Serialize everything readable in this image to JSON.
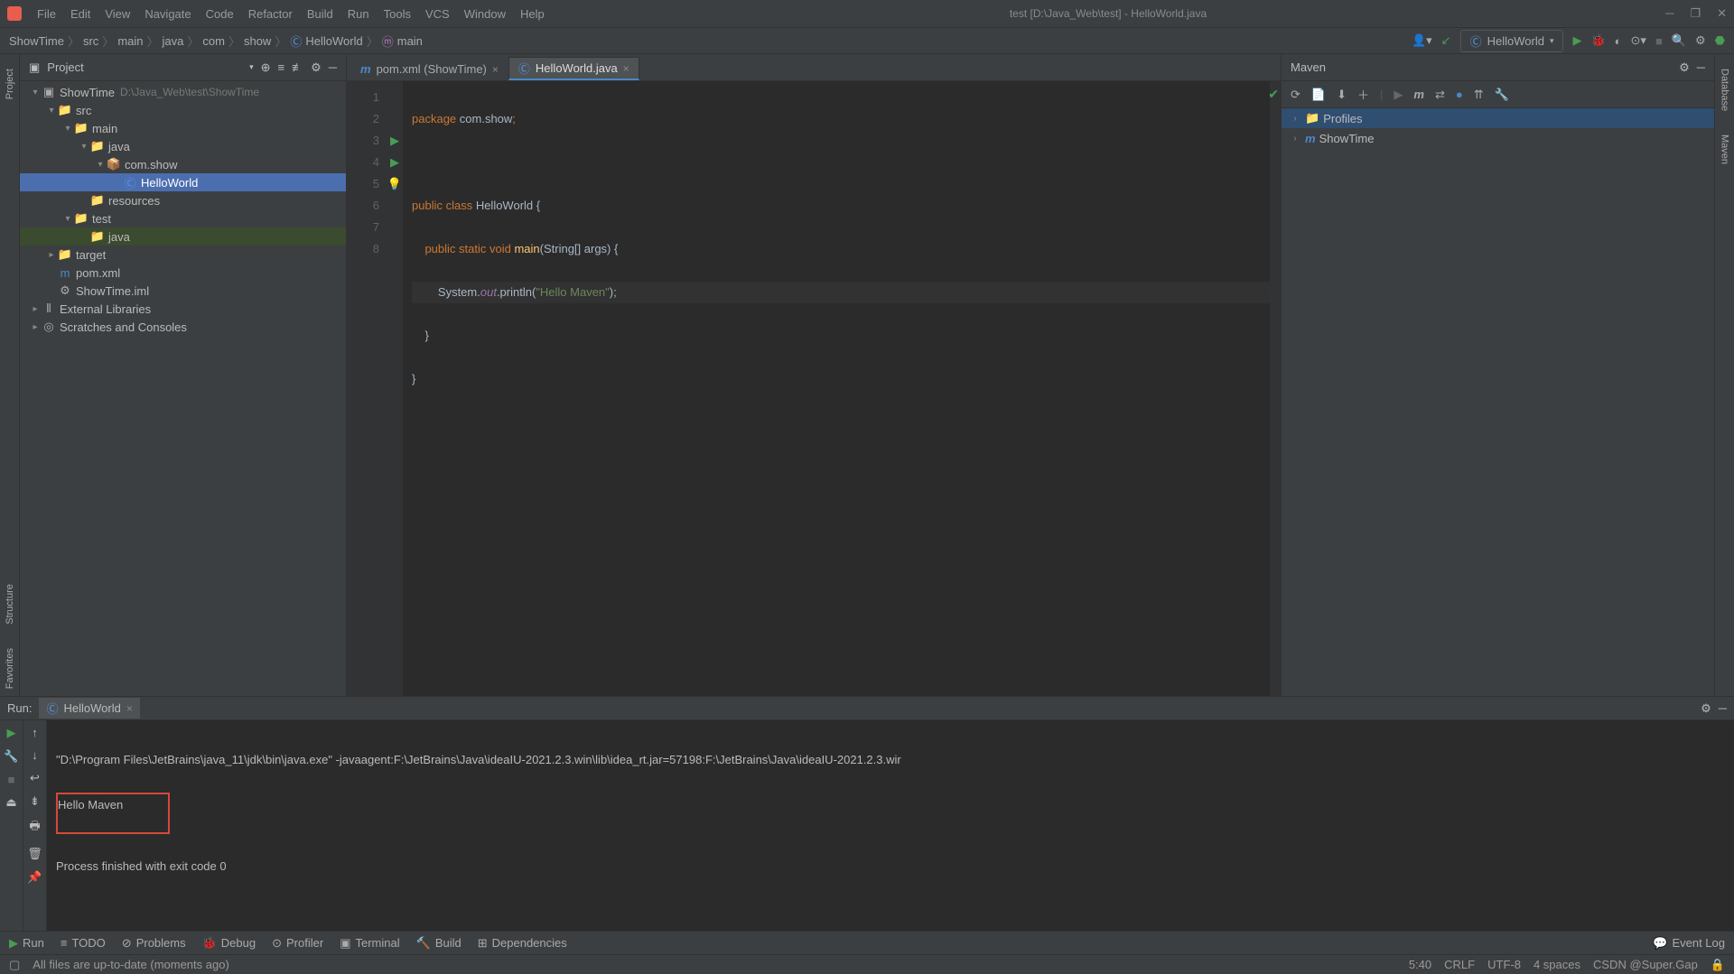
{
  "window": {
    "title": "test [D:\\Java_Web\\test] - HelloWorld.java"
  },
  "menu": [
    "File",
    "Edit",
    "View",
    "Navigate",
    "Code",
    "Refactor",
    "Build",
    "Run",
    "Tools",
    "VCS",
    "Window",
    "Help"
  ],
  "breadcrumbs": [
    "ShowTime",
    "src",
    "main",
    "java",
    "com",
    "show",
    "HelloWorld",
    "main"
  ],
  "runconfig": "HelloWorld",
  "left_tabs": [
    "Project",
    "Structure",
    "Favorites"
  ],
  "right_tabs": [
    "Database",
    "Maven"
  ],
  "project": {
    "title": "Project",
    "tree": [
      {
        "d": 0,
        "exp": "v",
        "icon": "mod",
        "label": "ShowTime",
        "hint": "D:\\Java_Web\\test\\ShowTime"
      },
      {
        "d": 1,
        "exp": "v",
        "icon": "fsrc",
        "label": "src"
      },
      {
        "d": 2,
        "exp": "v",
        "icon": "fld",
        "label": "main"
      },
      {
        "d": 3,
        "exp": "v",
        "icon": "fsrc",
        "label": "java"
      },
      {
        "d": 4,
        "exp": "v",
        "icon": "pkg",
        "label": "com.show"
      },
      {
        "d": 5,
        "exp": "",
        "icon": "cls",
        "label": "HelloWorld",
        "sel": true
      },
      {
        "d": 3,
        "exp": "",
        "icon": "fres",
        "label": "resources"
      },
      {
        "d": 2,
        "exp": "v",
        "icon": "fld",
        "label": "test"
      },
      {
        "d": 3,
        "exp": "",
        "icon": "ftst",
        "label": "java",
        "tgt": true
      },
      {
        "d": 1,
        "exp": ">",
        "icon": "ftgt",
        "label": "target"
      },
      {
        "d": 1,
        "exp": "",
        "icon": "mvn",
        "label": "pom.xml"
      },
      {
        "d": 1,
        "exp": "",
        "icon": "iml",
        "label": "ShowTime.iml"
      },
      {
        "d": 0,
        "exp": ">",
        "icon": "lib",
        "label": "External Libraries"
      },
      {
        "d": 0,
        "exp": ">",
        "icon": "scr",
        "label": "Scratches and Consoles"
      }
    ]
  },
  "editor": {
    "tabs": [
      {
        "label": "pom.xml (ShowTime)",
        "icon": "mvn",
        "active": false
      },
      {
        "label": "HelloWorld.java",
        "icon": "cls",
        "active": true
      }
    ],
    "lines": [
      "1",
      "2",
      "3",
      "4",
      "5",
      "6",
      "7",
      "8"
    ]
  },
  "code": {
    "l1a": "package",
    "l1b": " com.show",
    "l1c": ";",
    "l3a": "public class ",
    "l3b": "HelloWorld {",
    "l4a": "    public static void ",
    "l4b": "main",
    "l4c": "(String[] args) {",
    "l5a": "        System.",
    "l5b": "out",
    "l5c": ".println(",
    "l5d": "\"Hello Maven\"",
    "l5e": ");",
    "l6": "    }",
    "l7": "}"
  },
  "maven": {
    "title": "Maven",
    "nodes": [
      {
        "label": "Profiles",
        "sel": true,
        "icon": "prof"
      },
      {
        "label": "ShowTime",
        "icon": "mvn"
      }
    ]
  },
  "run": {
    "label": "Run:",
    "tab": "HelloWorld",
    "out1": "\"D:\\Program Files\\JetBrains\\java_11\\jdk\\bin\\java.exe\" -javaagent:F:\\JetBrains\\Java\\ideaIU-2021.2.3.win\\lib\\idea_rt.jar=57198:F:\\JetBrains\\Java\\ideaIU-2021.2.3.wir",
    "out2": "Hello Maven",
    "out3": "Process finished with exit code 0"
  },
  "tool_tabs": [
    "Run",
    "TODO",
    "Problems",
    "Debug",
    "Profiler",
    "Terminal",
    "Build",
    "Dependencies"
  ],
  "eventlog": "Event Log",
  "status": {
    "msg": "All files are up-to-date (moments ago)",
    "pos": "5:40",
    "crlf": "CRLF",
    "enc": "UTF-8",
    "indent": "4 spaces",
    "watermark": "CSDN @Super.Gap"
  }
}
